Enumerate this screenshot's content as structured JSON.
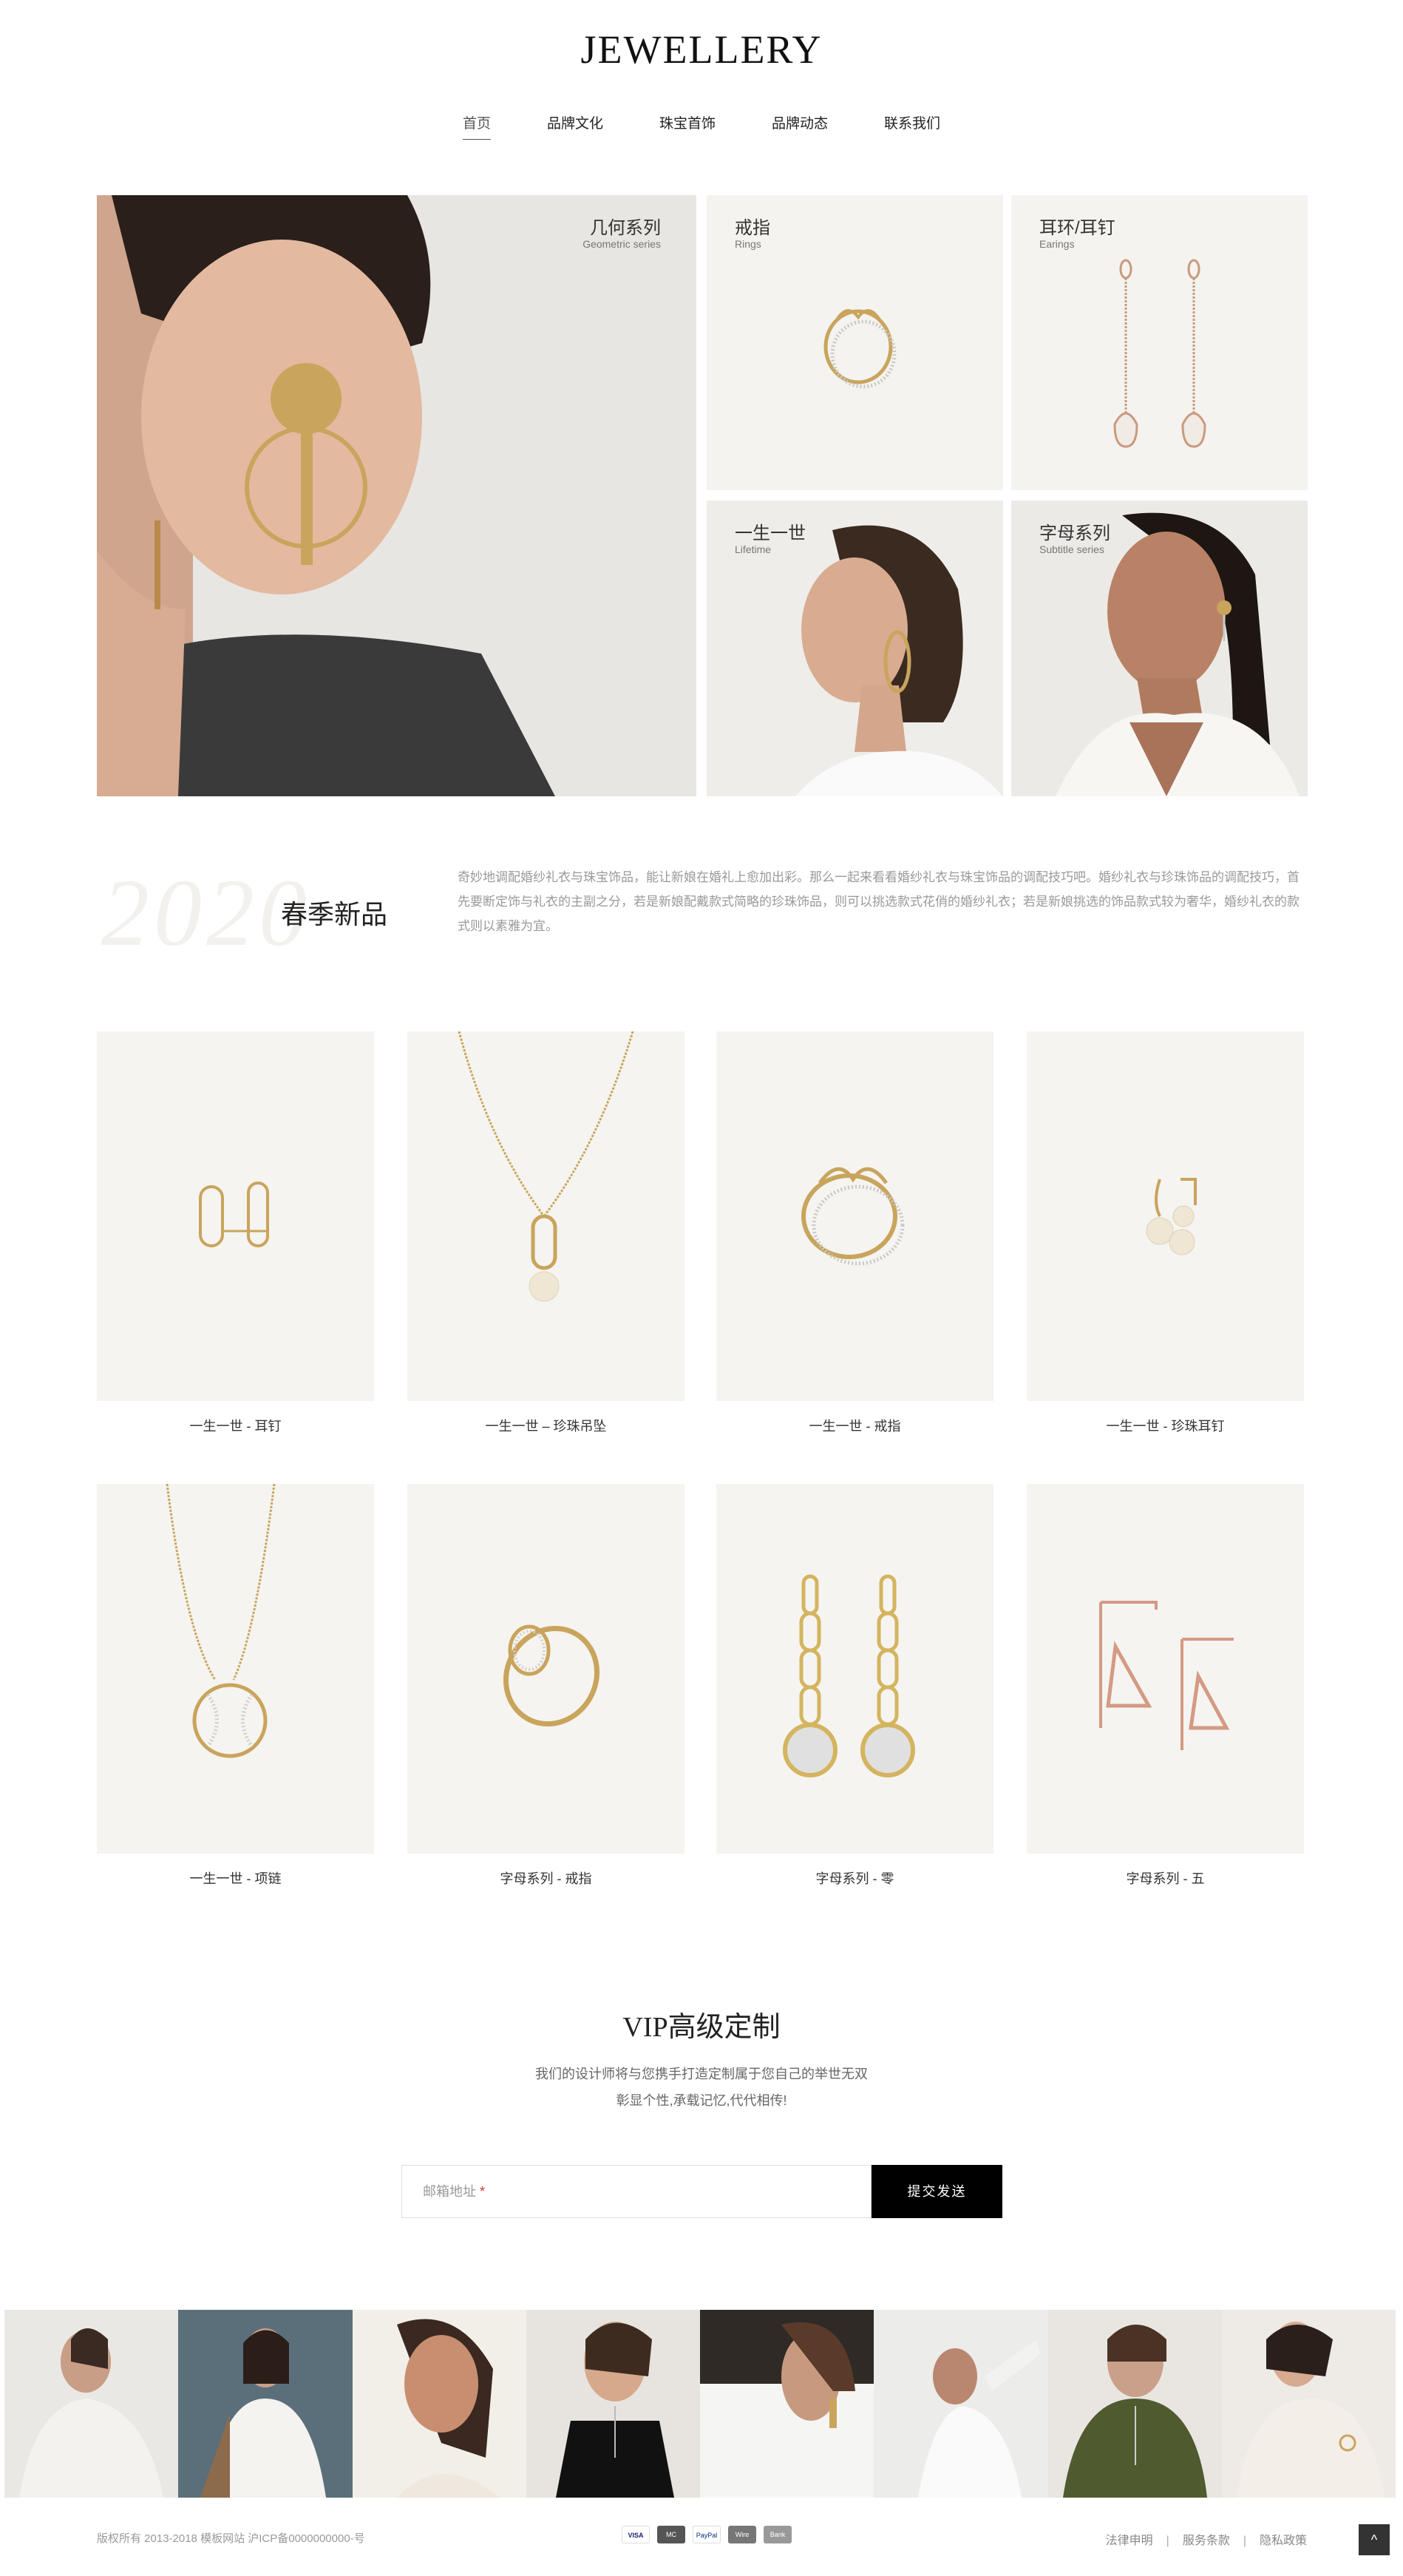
{
  "header": {
    "logo": "JEWELLERY",
    "nav": [
      "首页",
      "品牌文化",
      "珠宝首饰",
      "品牌动态",
      "联系我们"
    ]
  },
  "feature": {
    "geometric": {
      "title": "几何系列",
      "sub": "Geometric series"
    },
    "rings": {
      "title": "戒指",
      "sub": "Rings"
    },
    "earings": {
      "title": "耳环/耳钉",
      "sub": "Earings"
    },
    "lifetime": {
      "title": "一生一世",
      "sub": "Lifetime"
    },
    "letters": {
      "title": "字母系列",
      "sub": "Subtitle series"
    }
  },
  "spring": {
    "year": "2020",
    "title": "春季新品",
    "desc": "奇妙地调配婚纱礼衣与珠宝饰品，能让新娘在婚礼上愈加出彩。那么一起来看看婚纱礼衣与珠宝饰品的调配技巧吧。婚纱礼衣与珍珠饰品的调配技巧，首先要断定饰与礼衣的主副之分，若是新娘配戴款式简略的珍珠饰品，则可以挑选款式花俏的婚纱礼衣；若是新娘挑选的饰品款式较为奢华，婚纱礼衣的款式则以素雅为宜。"
  },
  "products": [
    {
      "name": "一生一世 - 耳钉",
      "type": "earpin"
    },
    {
      "name": "一生一世 – 珍珠吊坠",
      "type": "pendant"
    },
    {
      "name": "一生一世 - 戒指",
      "type": "ring"
    },
    {
      "name": "一生一世 - 珍珠耳钉",
      "type": "pearl"
    },
    {
      "name": "一生一世 - 项链",
      "type": "necklace"
    },
    {
      "name": "字母系列 - 戒指",
      "type": "ring2"
    },
    {
      "name": "字母系列 - 零",
      "type": "drops"
    },
    {
      "name": "字母系列 - 五",
      "type": "triangle"
    }
  ],
  "vip": {
    "title": "VIP高级定制",
    "line1": "我们的设计师将与您携手打造定制属于您自己的举世无双",
    "line2": "彰显个性,承载记忆,代代相传!",
    "placeholder": "邮箱地址",
    "required_mark": "*",
    "submit": "提交发送"
  },
  "footer": {
    "copyright": "版权所有 2013-2018 模板网站 沪ICP备0000000000-号",
    "payments": [
      "VISA",
      "MC",
      "PayPal",
      "Wire",
      "Bank"
    ],
    "links": [
      "法律申明",
      "服务条款",
      "隐私政策"
    ],
    "top": "^"
  },
  "colors": {
    "accent": "#000000",
    "tile_bg": "#f5f4f0",
    "gold": "#c9a45c"
  }
}
